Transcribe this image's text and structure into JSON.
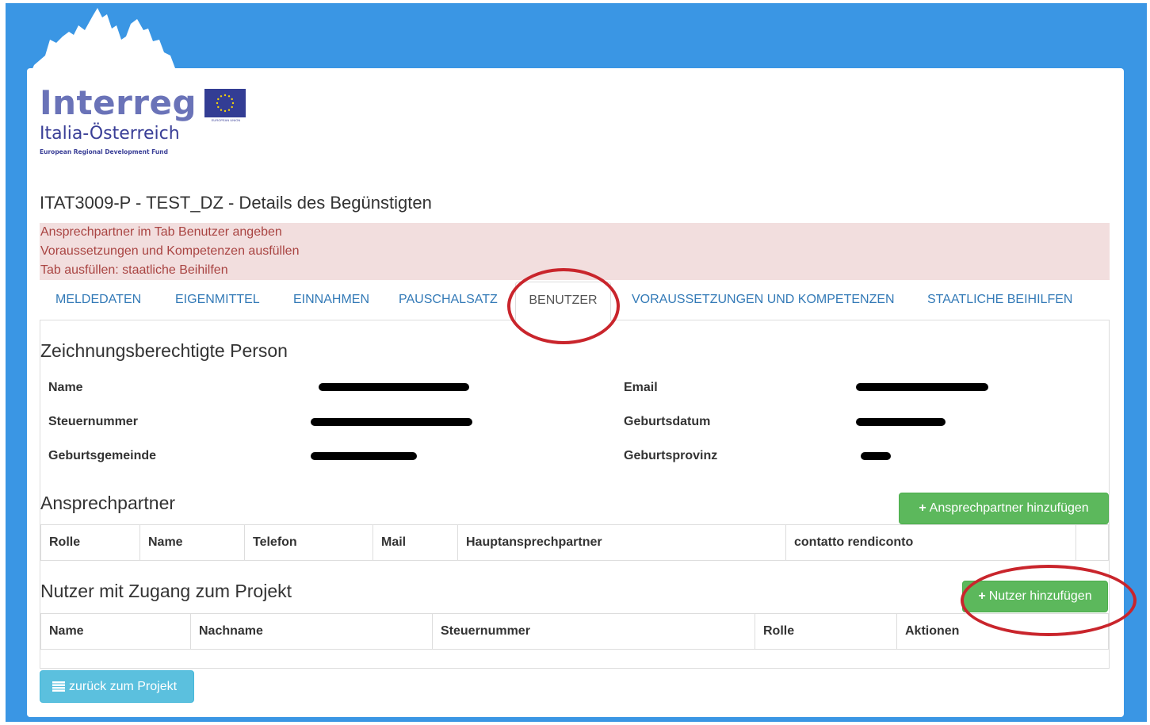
{
  "logo": {
    "wordmark": "Interreg",
    "program": "Italia-Österreich",
    "fund": "European Regional Development Fund",
    "eu_caption": "EUROPEAN UNION"
  },
  "page": {
    "title": "ITAT3009-P - TEST_DZ - Details des Begünstigten"
  },
  "alert": {
    "lines": [
      "Ansprechpartner im Tab Benutzer angeben",
      "Voraussetzungen und Kompetenzen ausfüllen",
      "Tab ausfüllen: staatliche Beihilfen"
    ]
  },
  "tabs": [
    {
      "label": "MELDEDATEN",
      "active": false
    },
    {
      "label": "EIGENMITTEL",
      "active": false
    },
    {
      "label": "EINNAHMEN",
      "active": false
    },
    {
      "label": "PAUSCHALSATZ",
      "active": false
    },
    {
      "label": "BENUTZER",
      "active": true
    },
    {
      "label": "VORAUSSETZUNGEN UND KOMPETENZEN",
      "active": false
    },
    {
      "label": "STAATLICHE BEIHILFEN",
      "active": false
    }
  ],
  "signatory": {
    "heading": "Zeichnungsberechtigte Person",
    "fields": {
      "name": "Name",
      "email": "Email",
      "tax": "Steuernummer",
      "birthdate": "Geburtsdatum",
      "birthplace": "Geburtsgemeinde",
      "birthprovince": "Geburtsprovinz"
    }
  },
  "contacts": {
    "heading": "Ansprechpartner",
    "add_button": "Ansprechpartner hinzufügen",
    "columns": [
      "Rolle",
      "Name",
      "Telefon",
      "Mail",
      "Hauptansprechpartner",
      "contatto rendiconto",
      ""
    ]
  },
  "users": {
    "heading": "Nutzer mit Zugang zum Projekt",
    "add_button": "Nutzer hinzufügen",
    "columns": [
      "Name",
      "Nachname",
      "Steuernummer",
      "Rolle",
      "Aktionen"
    ]
  },
  "back_button": "zurück zum Projekt",
  "colors": {
    "background": "#3a96e4",
    "link": "#337ab7",
    "success": "#5cb85c",
    "info": "#5bc0de",
    "alert_bg": "#f2dede",
    "alert_text": "#a94442",
    "annotation": "#c9252c"
  }
}
